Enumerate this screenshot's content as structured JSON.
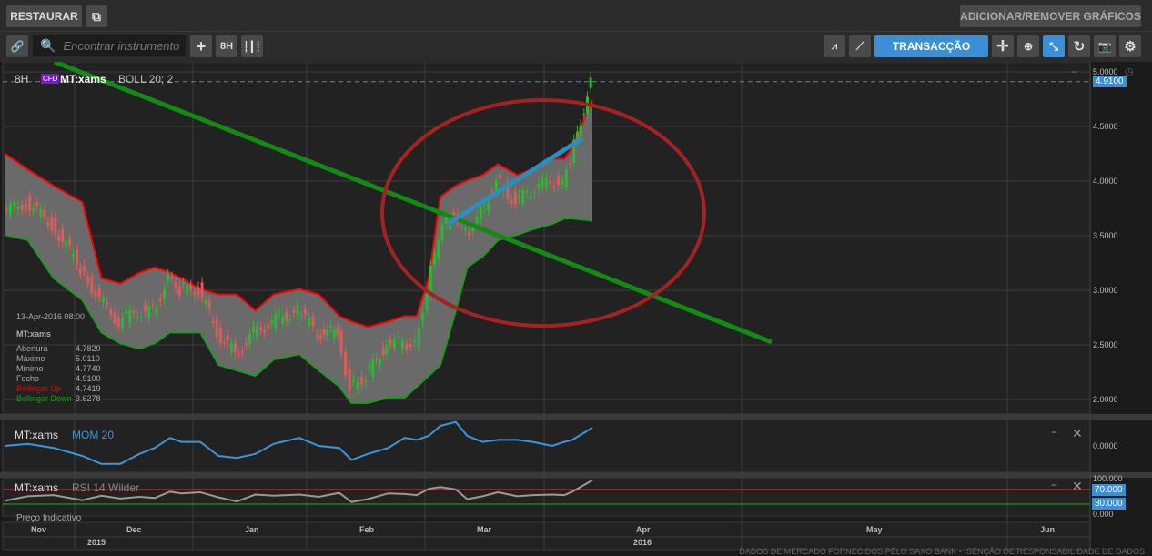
{
  "toolbar": {
    "restore_label": "RESTAURAR",
    "popout_icon": "external-link-icon",
    "add_remove_label": "ADICIONAR/REMOVER GRÁFICOS",
    "search_placeholder": "Encontrar instrumento",
    "timeframe": "8H",
    "trade_label": "TRANSACÇÃO"
  },
  "legend": {
    "timeframe": "8H",
    "badge": "CFD",
    "instrument": "MT:xams",
    "indicator": "BOLL 20; 2"
  },
  "info": {
    "datetime": "13-Apr-2016 08:00",
    "instrument": "MT:xams",
    "rows": [
      {
        "label": "Abertura",
        "value": "4.7820"
      },
      {
        "label": "Máximo",
        "value": "5.0110"
      },
      {
        "label": "Mínimo",
        "value": "4.7740"
      },
      {
        "label": "Fecho",
        "value": "4.9100"
      },
      {
        "label": "Bollinger Up",
        "value": "4.7419"
      },
      {
        "label": "Bollinger Down",
        "value": "3.6278"
      }
    ]
  },
  "price_axis": [
    "5.0000",
    "4.5000",
    "4.0000",
    "3.5000",
    "3.0000",
    "2.5000",
    "2.0000"
  ],
  "last_price": "4.9100",
  "mom": {
    "instrument": "MT:xams",
    "label": "MOM 20",
    "axis": "0.0000"
  },
  "rsi": {
    "instrument": "MT:xams",
    "label": "RSI 14 Wilder",
    "axis_top": "100.000",
    "axis_bottom": "0.000",
    "upper": "70.000",
    "lower": "30.000"
  },
  "indicative": "Preço Indicativo",
  "months": [
    "Nov",
    "Dec",
    "Jan",
    "Feb",
    "Mar",
    "Apr",
    "May",
    "Jun"
  ],
  "years": [
    "2015",
    "2016"
  ],
  "footer": "DADOS DE MERCADO FORNECIDOS PELO SAXO BANK • ISENÇÃO DE RESPONSABILIDADE DE DADOS",
  "colors": {
    "up": "#2db82d",
    "down": "#e05a5a",
    "band_up": "#ff0000",
    "band_down": "#1f9a1f",
    "accent": "#3a8fd6"
  },
  "chart_data": {
    "type": "candlestick",
    "title": "MT:xams 8H",
    "dates": [
      "2015-11-01",
      "2015-11-11",
      "2015-11-22",
      "2015-12-03",
      "2015-12-08",
      "2015-12-13",
      "2015-12-18",
      "2015-12-22",
      "2015-12-26",
      "2015-12-29",
      "2016-01-03",
      "2016-01-08",
      "2016-01-13",
      "2016-01-18",
      "2016-01-23",
      "2016-01-30",
      "2016-02-04",
      "2016-02-09",
      "2016-02-12",
      "2016-02-16",
      "2016-02-21",
      "2016-02-25",
      "2016-02-28",
      "2016-03-02",
      "2016-03-05",
      "2016-03-09",
      "2016-03-12",
      "2016-03-16",
      "2016-03-20",
      "2016-03-25",
      "2016-03-29",
      "2016-04-03",
      "2016-04-06",
      "2016-04-08",
      "2016-04-13"
    ],
    "close": [
      3.7,
      3.8,
      3.6,
      3.2,
      2.9,
      2.7,
      2.8,
      2.8,
      3.1,
      3.0,
      3.0,
      2.6,
      2.4,
      2.6,
      2.7,
      2.8,
      2.6,
      2.6,
      2.1,
      2.2,
      2.5,
      2.5,
      2.5,
      3.0,
      3.5,
      3.7,
      3.5,
      3.7,
      4.0,
      3.8,
      3.9,
      4.0,
      4.0,
      4.2,
      4.91
    ],
    "boll_up": [
      4.25,
      4.1,
      3.95,
      3.8,
      3.1,
      3.05,
      3.15,
      3.2,
      3.15,
      3.1,
      3.0,
      2.95,
      2.95,
      2.8,
      2.95,
      3.0,
      2.95,
      2.75,
      2.7,
      2.65,
      2.7,
      2.75,
      2.75,
      3.1,
      3.85,
      3.95,
      4.0,
      4.05,
      4.15,
      4.05,
      4.1,
      4.2,
      4.2,
      4.3,
      4.74
    ],
    "boll_down": [
      3.5,
      3.45,
      3.1,
      2.9,
      2.6,
      2.5,
      2.45,
      2.5,
      2.6,
      2.6,
      2.6,
      2.3,
      2.25,
      2.2,
      2.35,
      2.4,
      2.25,
      2.1,
      1.95,
      1.95,
      2.0,
      2.0,
      2.1,
      2.2,
      2.3,
      2.8,
      3.2,
      3.3,
      3.45,
      3.5,
      3.55,
      3.6,
      3.65,
      3.65,
      3.63
    ],
    "ylim": [
      1.9,
      5.1
    ]
  }
}
